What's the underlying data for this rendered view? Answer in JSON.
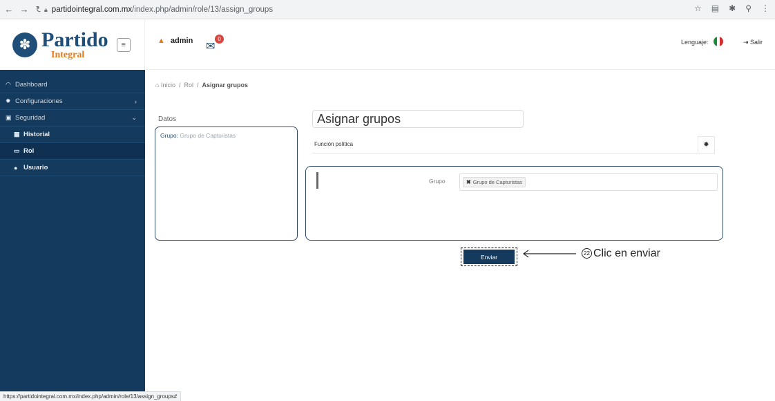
{
  "browser": {
    "url_host": "partidointegral.com.mx",
    "url_path": "/index.php/admin/role/13/assign_groups",
    "status_url": "https://partidointegral.com.mx/index.php/admin/role/13/assign_groups#"
  },
  "logo": {
    "line1": "Partido",
    "line2": "Integral"
  },
  "sidebar": {
    "items": [
      {
        "label": "Dashboard",
        "icon": "dashboard-icon"
      },
      {
        "label": "Configuraciones",
        "icon": "gear-icon"
      },
      {
        "label": "Seguridad",
        "icon": "lock-icon"
      },
      {
        "label": "Historial",
        "icon": "calendar-icon"
      },
      {
        "label": "Rol",
        "icon": "card-icon"
      },
      {
        "label": "Usuario",
        "icon": "user-icon"
      }
    ]
  },
  "topbar": {
    "user": "admin",
    "notifications": "0",
    "language_label": "Lenguaje:",
    "logout": "Salir"
  },
  "breadcrumb": {
    "home": "Inicio",
    "rol": "Rol",
    "current": "Asignar grupos"
  },
  "datos": {
    "title": "Datos",
    "key": "Grupo:",
    "value": "Grupo de Capturistas"
  },
  "form": {
    "title": "Asignar grupos",
    "funcion": "Función política",
    "grupo_label": "Grupo",
    "tag": "Grupo de Capturistas",
    "submit": "Enviar"
  },
  "annotation": {
    "number": "22",
    "text": "Clic en enviar"
  },
  "colors": {
    "sidebar": "#143b5e",
    "accent": "#e07b1c",
    "badge": "#d9453c"
  }
}
